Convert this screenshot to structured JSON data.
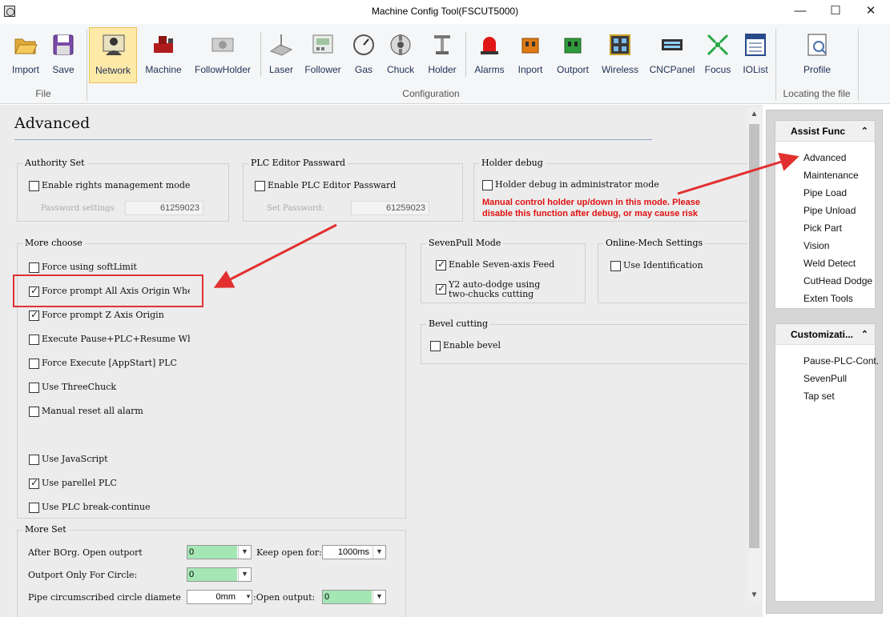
{
  "window": {
    "title": "Machine Config Tool(FSCUT5000)",
    "min_glyph": "—",
    "max_glyph": "☐",
    "close_glyph": "✕"
  },
  "ribbon": {
    "groups": {
      "file": "File",
      "configuration": "Configuration",
      "locating": "Locating the file"
    },
    "tools": [
      {
        "label": "Import",
        "icon": "folder-open-icon"
      },
      {
        "label": "Save",
        "icon": "floppy-disk-icon"
      },
      {
        "label": "Network",
        "icon": "network-person-icon",
        "active": true
      },
      {
        "label": "Machine",
        "icon": "machine-icon"
      },
      {
        "label": "FollowHolder",
        "icon": "follow-holder-icon"
      },
      {
        "label": "Laser",
        "icon": "laser-icon"
      },
      {
        "label": "Follower",
        "icon": "follower-icon"
      },
      {
        "label": "Gas",
        "icon": "gas-gauge-icon"
      },
      {
        "label": "Chuck",
        "icon": "chuck-icon"
      },
      {
        "label": "Holder",
        "icon": "holder-icon"
      },
      {
        "label": "Alarms",
        "icon": "alarm-light-icon"
      },
      {
        "label": "Inport",
        "icon": "inport-icon"
      },
      {
        "label": "Outport",
        "icon": "outport-icon"
      },
      {
        "label": "Wireless",
        "icon": "wireless-icon"
      },
      {
        "label": "CNCPanel",
        "icon": "cnc-panel-icon"
      },
      {
        "label": "Focus",
        "icon": "focus-icon"
      },
      {
        "label": "IOList",
        "icon": "io-list-icon"
      },
      {
        "label": "Profile",
        "icon": "profile-icon"
      }
    ]
  },
  "page": {
    "title": "Advanced"
  },
  "authority": {
    "legend": "Authority Set",
    "enable_label": "Enable rights management mode",
    "password_label": "Password settings",
    "password_value": "61259023"
  },
  "plc_editor": {
    "legend": "PLC Editor Passward",
    "enable_label": "Enable PLC Editor Passward",
    "password_label": "Set Password:",
    "password_value": "61259023"
  },
  "holder_debug": {
    "legend": "Holder debug",
    "enable_label": "Holder debug in administrator mode",
    "warning_line1": "Manual control holder up/down in this mode. Please",
    "warning_line2": "disable this function after debug, or may cause risk"
  },
  "more_choose": {
    "legend": "More choose",
    "items": [
      {
        "label": "Force using softLimit",
        "checked": false
      },
      {
        "label": "Force prompt All Axis Origin When",
        "checked": true
      },
      {
        "label": "Force prompt Z Axis Origin",
        "checked": true
      },
      {
        "label": "Execute Pause+PLC+Resume When J",
        "checked": false
      },
      {
        "label": "Force Execute [AppStart] PLC",
        "checked": false
      },
      {
        "label": "Use ThreeChuck",
        "checked": false
      },
      {
        "label": "Manual reset all alarm",
        "checked": false
      },
      {
        "label": "Use JavaScript",
        "checked": false
      },
      {
        "label": "Use parellel PLC",
        "checked": true
      },
      {
        "label": "Use PLC break-continue",
        "checked": false
      }
    ]
  },
  "seven_pull": {
    "legend": "SevenPull Mode",
    "feed_label": "Enable Seven-axis Feed",
    "dodge_line1": "Y2 auto-dodge using",
    "dodge_line2": "two-chucks cutting"
  },
  "online_mech": {
    "legend": "Online-Mech Settings",
    "ident_label": "Use Identification"
  },
  "bevel": {
    "legend": "Bevel cutting",
    "enable_label": "Enable bevel"
  },
  "more_set": {
    "legend": "More Set",
    "after_borg_label": "After BOrg. Open outport",
    "after_borg_value": "0",
    "keep_open_label": "Keep open for:",
    "keep_open_value": "1000ms",
    "outport_circle_label": "Outport Only For Circle:",
    "outport_circle_value": "0",
    "pipe_label": "Pipe circumscribed circle diamete",
    "pipe_value": "0mm",
    "open_output_label": ":Open output:",
    "open_output_value": "0"
  },
  "assist": {
    "header": "Assist Func",
    "items": [
      "Advanced",
      "Maintenance",
      "Pipe Load",
      "Pipe Unload",
      "Pick Part",
      "Vision",
      "Weld Detect",
      "CutHead Dodge",
      "Exten Tools"
    ]
  },
  "customization": {
    "header": "Customizati...",
    "items": [
      "Pause-PLC-Cont.",
      "SevenPull",
      "Tap set"
    ]
  },
  "colors": {
    "accent_red": "#e23030",
    "combo_green": "#a5e6b5",
    "active_tool": "#fde9a8"
  }
}
